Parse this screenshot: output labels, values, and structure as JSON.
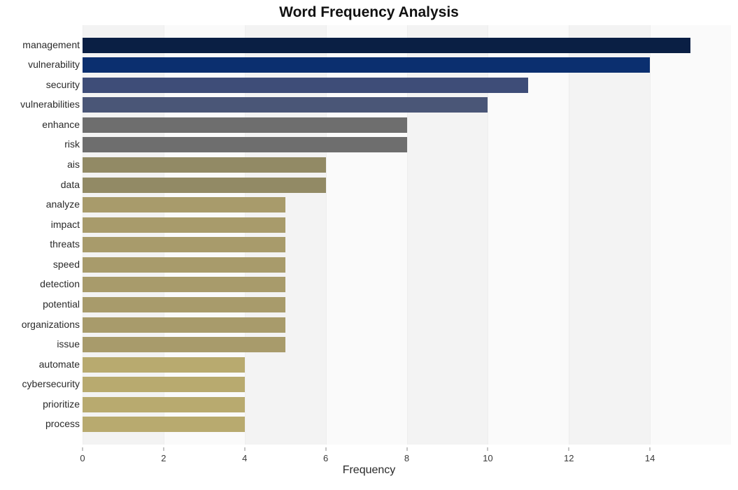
{
  "chart_data": {
    "type": "bar",
    "orientation": "horizontal",
    "title": "Word Frequency Analysis",
    "xlabel": "Frequency",
    "ylabel": "",
    "xlim": [
      0,
      16
    ],
    "xticks": [
      0,
      2,
      4,
      6,
      8,
      10,
      12,
      14
    ],
    "categories": [
      "management",
      "vulnerability",
      "security",
      "vulnerabilities",
      "enhance",
      "risk",
      "ais",
      "data",
      "analyze",
      "impact",
      "threats",
      "speed",
      "detection",
      "potential",
      "organizations",
      "issue",
      "automate",
      "cybersecurity",
      "prioritize",
      "process"
    ],
    "values": [
      15,
      14,
      11,
      10,
      8,
      8,
      6,
      6,
      5,
      5,
      5,
      5,
      5,
      5,
      5,
      5,
      4,
      4,
      4,
      4
    ],
    "colors": [
      "#0a1f44",
      "#0b2f6f",
      "#3e4d78",
      "#4a5677",
      "#6e6e6e",
      "#6e6e6e",
      "#928a65",
      "#928a65",
      "#a89b6b",
      "#a89b6b",
      "#a89b6b",
      "#a89b6b",
      "#a89b6b",
      "#a89b6b",
      "#a89b6b",
      "#a89b6b",
      "#b8aa6f",
      "#b8aa6f",
      "#b8aa6f",
      "#b8aa6f"
    ]
  }
}
